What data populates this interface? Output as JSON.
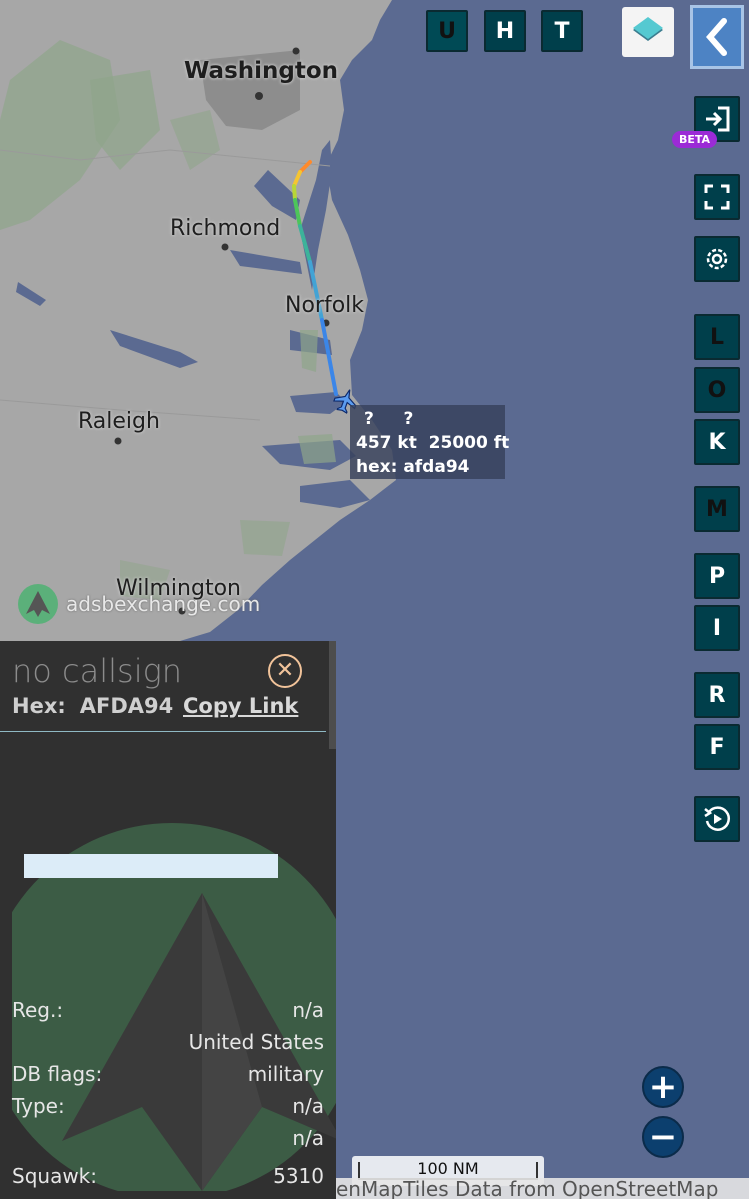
{
  "map": {
    "cities": {
      "washington": "Washington",
      "richmond": "Richmond",
      "norfolk": "Norfolk",
      "raleigh": "Raleigh",
      "wilmington": "Wilmington"
    },
    "aircraft_label": {
      "line1": "?     ?",
      "line2": "457 kt  25000 ft",
      "line3": "hex: afda94"
    },
    "brand": "adsbexchange.com",
    "scale": "100 NM",
    "attribution": "enMapTiles Data from OpenStreetMap"
  },
  "top_buttons": {
    "u": "U",
    "h": "H",
    "t": "T"
  },
  "side_buttons": {
    "beta": "BETA",
    "l": "L",
    "o": "O",
    "k": "K",
    "m": "M",
    "p": "P",
    "i": "I",
    "r": "R",
    "f": "F"
  },
  "zoom": {
    "in": "+",
    "out": "−"
  },
  "panel": {
    "callsign": "no callsign",
    "hex_label": "Hex:",
    "hex_value": "AFDA94",
    "copy_link": "Copy Link",
    "rows": [
      {
        "label": "Reg.:",
        "value": "n/a"
      },
      {
        "label": "",
        "value": "United States"
      },
      {
        "label": "DB flags:",
        "value": "military"
      },
      {
        "label": "Type:",
        "value": "n/a"
      },
      {
        "label": "",
        "value": "n/a"
      },
      {
        "label": "Squawk:",
        "value": "5310"
      }
    ]
  },
  "colors": {
    "sea": "#5b6a91",
    "land": "#a7a7a7",
    "button": "#003f4b",
    "panel": "#303030",
    "beta": "#9b2bd6"
  }
}
